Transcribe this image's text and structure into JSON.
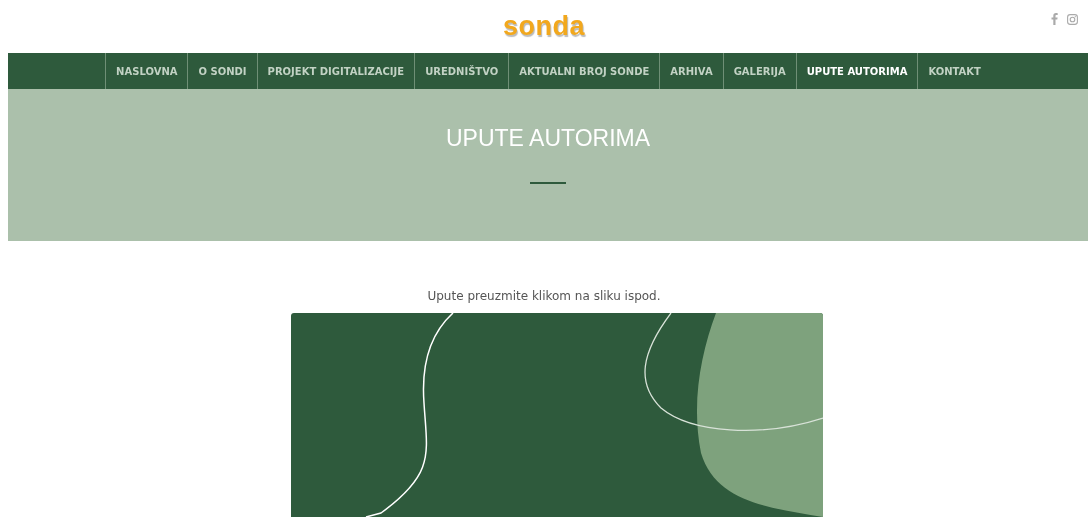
{
  "logo": {
    "text": "sonda"
  },
  "nav": [
    {
      "label": "NASLOVNA",
      "selected": false
    },
    {
      "label": "O SONDI",
      "selected": false
    },
    {
      "label": "PROJEKT DIGITALIZACIJE",
      "selected": false
    },
    {
      "label": "UREDNIŠTVO",
      "selected": false
    },
    {
      "label": "AKTUALNI BROJ SONDE",
      "selected": false
    },
    {
      "label": "ARHIVA",
      "selected": false
    },
    {
      "label": "GALERIJA",
      "selected": false
    },
    {
      "label": "UPUTE AUTORIMA",
      "selected": true
    },
    {
      "label": "KONTAKT",
      "selected": false
    }
  ],
  "hero": {
    "title": "UPUTE AUTORIMA"
  },
  "intro": "Upute preuzmite klikom na sliku ispod."
}
